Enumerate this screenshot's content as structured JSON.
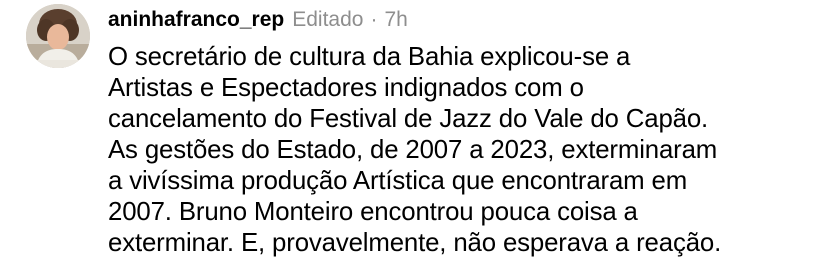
{
  "comment": {
    "username": "aninhafranco_rep",
    "edited_label": "Editado",
    "separator": "·",
    "time": "7h",
    "avatar_icon": "user-photo-avatar",
    "text_lines": [
      "O secretário de cultura da Bahia explicou-se a",
      "Artistas e Espectadores indignados com o",
      "cancelamento do Festival de Jazz do Vale do Capão.",
      "As gestões do Estado, de 2007 a 2023, exterminaram",
      "a vivíssima produção Artística que encontraram em",
      "2007. Bruno Monteiro encontrou pouca coisa a",
      "exterminar. E, provavelmente, não esperava a reação."
    ]
  },
  "colors": {
    "text": "#000000",
    "meta": "#8e8e8e",
    "background": "#ffffff"
  }
}
